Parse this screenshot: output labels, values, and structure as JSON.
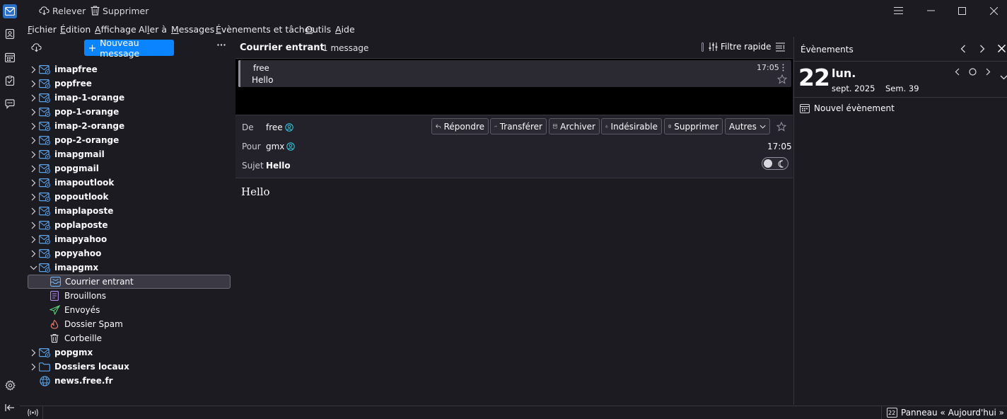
{
  "toolbar": {
    "get_messages": "Relever",
    "delete": "Supprimer"
  },
  "menu": [
    "Fichier",
    "Édition",
    "Affichage",
    "Aller à",
    "Messages",
    "Évènements et tâches",
    "Outils",
    "Aide"
  ],
  "folder_pane": {
    "new_message": "Nouveau message",
    "folders": [
      {
        "label": "imapfree",
        "bold": true,
        "icon": "account-mail-icon"
      },
      {
        "label": "popfree",
        "bold": true,
        "icon": "account-mail-icon"
      },
      {
        "label": "imap-1-orange",
        "bold": true,
        "icon": "account-mail-icon"
      },
      {
        "label": "pop-1-orange",
        "bold": true,
        "icon": "account-mail-icon"
      },
      {
        "label": "imap-2-orange",
        "bold": true,
        "icon": "account-mail-icon"
      },
      {
        "label": "pop-2-orange",
        "bold": true,
        "icon": "account-mail-icon"
      },
      {
        "label": "imapgmail",
        "bold": true,
        "icon": "account-mail-icon"
      },
      {
        "label": "popgmail",
        "bold": true,
        "icon": "account-mail-icon"
      },
      {
        "label": "imapoutlook",
        "bold": true,
        "icon": "account-mail-icon"
      },
      {
        "label": "popoutlook",
        "bold": true,
        "icon": "account-mail-icon"
      },
      {
        "label": "imaplaposte",
        "bold": true,
        "icon": "account-mail-icon"
      },
      {
        "label": "poplaposte",
        "bold": true,
        "icon": "account-mail-icon"
      },
      {
        "label": "imapyahoo",
        "bold": true,
        "icon": "account-mail-icon"
      },
      {
        "label": "popyahoo",
        "bold": true,
        "icon": "account-mail-icon"
      },
      {
        "label": "imapgmx",
        "bold": true,
        "icon": "account-mail-icon",
        "expanded": true
      },
      {
        "label": "Courrier entrant",
        "bold": false,
        "icon": "inbox-icon",
        "child": true,
        "selected": true
      },
      {
        "label": "Brouillons",
        "bold": false,
        "icon": "drafts-icon",
        "child": true
      },
      {
        "label": "Envoyés",
        "bold": false,
        "icon": "sent-icon",
        "child": true
      },
      {
        "label": "Dossier Spam",
        "bold": false,
        "icon": "spam-icon",
        "child": true
      },
      {
        "label": "Corbeille",
        "bold": false,
        "icon": "trash-icon",
        "child": true
      },
      {
        "label": "popgmx",
        "bold": true,
        "icon": "account-mail-icon"
      },
      {
        "label": "Dossiers locaux",
        "bold": true,
        "icon": "local-folder-icon"
      },
      {
        "label": "news.free.fr",
        "bold": true,
        "icon": "newsgroup-globe-icon",
        "no_twisty": true
      }
    ]
  },
  "thread": {
    "folder_name": "Courrier entrant",
    "count": "1 message",
    "quick_filter": "Filtre rapide"
  },
  "message_card": {
    "sender": "free",
    "time": "17:05",
    "subject": "Hello"
  },
  "header": {
    "from_label": "De",
    "from_value": "free",
    "to_label": "Pour",
    "to_value": "gmx",
    "subject_label": "Sujet",
    "subject_value": "Hello",
    "time": "17:05",
    "actions": {
      "reply": "Répondre",
      "forward": "Transférer",
      "archive": "Archiver",
      "junk": "Indésirable",
      "delete": "Supprimer",
      "more": "Autres"
    }
  },
  "body": {
    "text": "Hello"
  },
  "events": {
    "title": "Évènements",
    "day_number": "22",
    "weekday": "lun.",
    "month_year": "sept. 2025",
    "week": "Sem. 39",
    "new_event": "Nouvel évènement"
  },
  "status": {
    "today_pane": "Panneau « Aujourd'hui »",
    "today_icon_day": "22"
  },
  "colors": {
    "accent": "#0a84ff",
    "account_icon": "#5aa3ea",
    "inbox_icon": "#73b2f0",
    "drafts_icon": "#b48ef0",
    "sent_icon": "#5fd17b",
    "spam_icon": "#ef7b6e",
    "contact_icon": "#33c2d6"
  }
}
